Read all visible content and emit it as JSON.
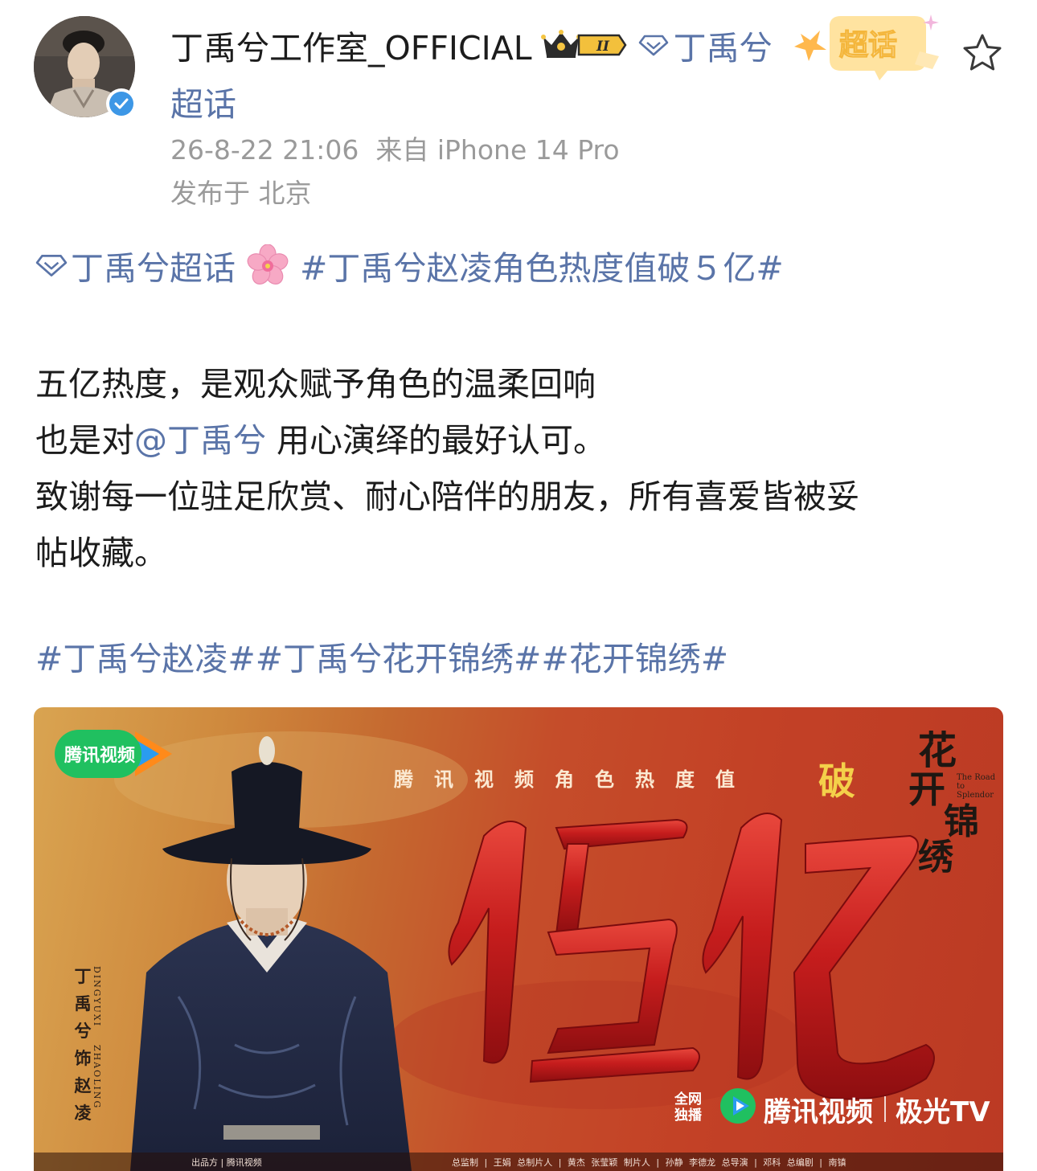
{
  "post": {
    "username": "丁禹兮工作室_OFFICIAL",
    "rank_badge": "II",
    "super_topic_line1": "丁禹兮",
    "super_topic_line2": "超话",
    "chaohua_badge_label": "超话",
    "timestamp": "26-8-22 21:06",
    "source": "来自 iPhone 14 Pro",
    "location": "发布于 北京"
  },
  "content": {
    "topic_link": "丁禹兮超话",
    "topic_hashtag": "#丁禹兮赵凌角色热度值破５亿#",
    "line1": "五亿热度，是观众赋予角色的温柔回响",
    "line2_prefix": "也是对",
    "line2_mention": "@丁禹兮",
    "line2_suffix": " 用心演绎的最好认可。",
    "line3": "致谢每一位驻足欣赏、耐心陪伴的朋友，所有喜爱皆被妥",
    "line4": "帖收藏。",
    "hashtags": "#丁禹兮赵凌##丁禹兮花开锦绣##花开锦绣#"
  },
  "poster": {
    "top_logo_text": "腾讯视频",
    "heat_label": "腾讯视频角色热度值",
    "po": "破",
    "headline": "伍亿",
    "title_chars": [
      "花",
      "开",
      "锦",
      "绣"
    ],
    "title_en": "The Road to Splendor",
    "actor_credit_zh": "丁禹兮饰赵凌",
    "actor_credit_en1": "DINGYUXI",
    "actor_credit_en2": "ZHAOLING",
    "exclusive": "全网独播",
    "bottom_brand": "腾讯视频",
    "bottom_partner": "极光TV",
    "credits_left": "出品方 |  腾讯视频",
    "credits_right": "总监制 | 王娟   总制片人 | 黄杰 张莹颖   制片人 | 孙静 李德龙   总导演 | 邓科   总编剧 | 南镇"
  },
  "colors": {
    "link": "#5a74a8",
    "meta": "#9a9a9a",
    "verify_blue": "#3d97e6",
    "poster_red": "#c34126"
  },
  "icons": [
    "verified-icon",
    "crown-icon",
    "diamond-icon",
    "chaohua-badge-icon",
    "star-icon",
    "flower-icon",
    "tencent-video-logo"
  ]
}
